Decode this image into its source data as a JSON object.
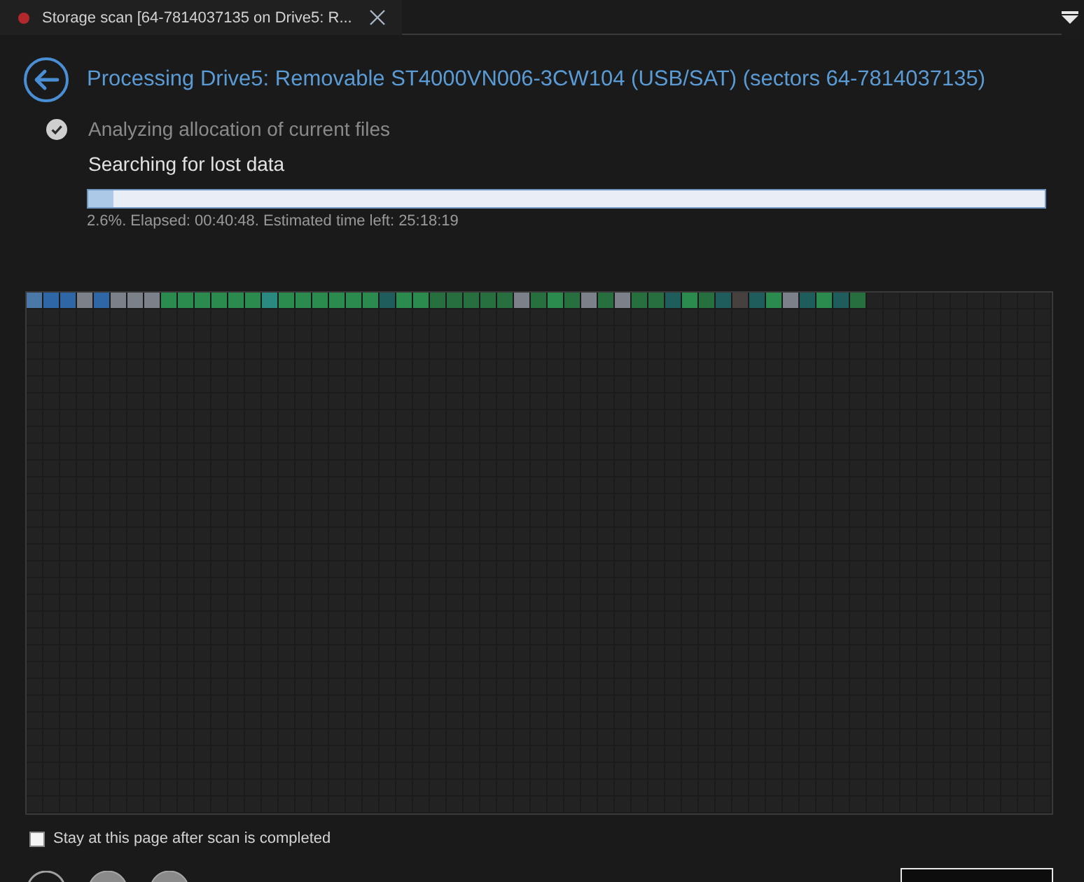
{
  "tabs": [
    {
      "label": "Storage scan [64-7814037135 on Drive5: R...",
      "selected": true
    }
  ],
  "header": {
    "title": "Processing Drive5: Removable ST4000VN006-3CW104 (USB/SAT) (sectors 64-7814037135)"
  },
  "steps": [
    {
      "label": "Analyzing allocation of current files",
      "done": true
    },
    {
      "label": "Searching for lost data",
      "done": false
    }
  ],
  "progress": {
    "level": 0.026,
    "status": "2.6%. Elapsed: 00:40:48. Estimated time left: 25:18:19"
  },
  "cluster_map": {
    "cells": [
      {
        "color": "#4b78a8"
      },
      {
        "color": "#2f66a6"
      },
      {
        "color": "#2f66a6"
      },
      {
        "color": "#7c8089"
      },
      {
        "color": "#2f66a6"
      },
      {
        "color": "#7c8089"
      },
      {
        "color": "#7c8089"
      },
      {
        "color": "#7c8089"
      },
      {
        "color": "#2b8a4e"
      },
      {
        "color": "#2b8a4e"
      },
      {
        "color": "#2b8a4e"
      },
      {
        "color": "#2b8a4e"
      },
      {
        "color": "#2b8a4e"
      },
      {
        "color": "#2b8a4e"
      },
      {
        "color": "#2b8a80"
      },
      {
        "color": "#2b8a4e"
      },
      {
        "color": "#2b8a4e"
      },
      {
        "color": "#2b8a4e"
      },
      {
        "color": "#2b8a4e"
      },
      {
        "color": "#2b8a4e"
      },
      {
        "color": "#2b8a4e"
      },
      {
        "color": "#1f5d5d"
      },
      {
        "color": "#2b8a4e"
      },
      {
        "color": "#2b8a4e"
      },
      {
        "color": "#286f3f"
      },
      {
        "color": "#286f3f"
      },
      {
        "color": "#286f3f"
      },
      {
        "color": "#286f3f"
      },
      {
        "color": "#286f3f"
      },
      {
        "color": "#7c8089"
      },
      {
        "color": "#286f3f"
      },
      {
        "color": "#2b8a4e"
      },
      {
        "color": "#286f3f"
      },
      {
        "color": "#7c8089"
      },
      {
        "color": "#286f3f"
      },
      {
        "color": "#7c8089"
      },
      {
        "color": "#286f3f"
      },
      {
        "color": "#286f3f"
      },
      {
        "color": "#1f5d5d"
      },
      {
        "color": "#2b8a4e"
      },
      {
        "color": "#286f3f"
      },
      {
        "color": "#1f5d5d"
      },
      {
        "color": "#46403f"
      },
      {
        "color": "#1f5d5d"
      },
      {
        "color": "#2b8a4e"
      },
      {
        "color": "#7c8089"
      },
      {
        "color": "#1f5d5d"
      },
      {
        "color": "#2b8a4e"
      },
      {
        "color": "#1f5d5d"
      },
      {
        "color": "#286f3f"
      }
    ]
  },
  "stay_option": {
    "label": "Stay at this page after scan is completed",
    "checked": false
  },
  "round_buttons": [
    {
      "kind": "outline"
    },
    {
      "kind": "filled"
    },
    {
      "kind": "filled"
    }
  ]
}
